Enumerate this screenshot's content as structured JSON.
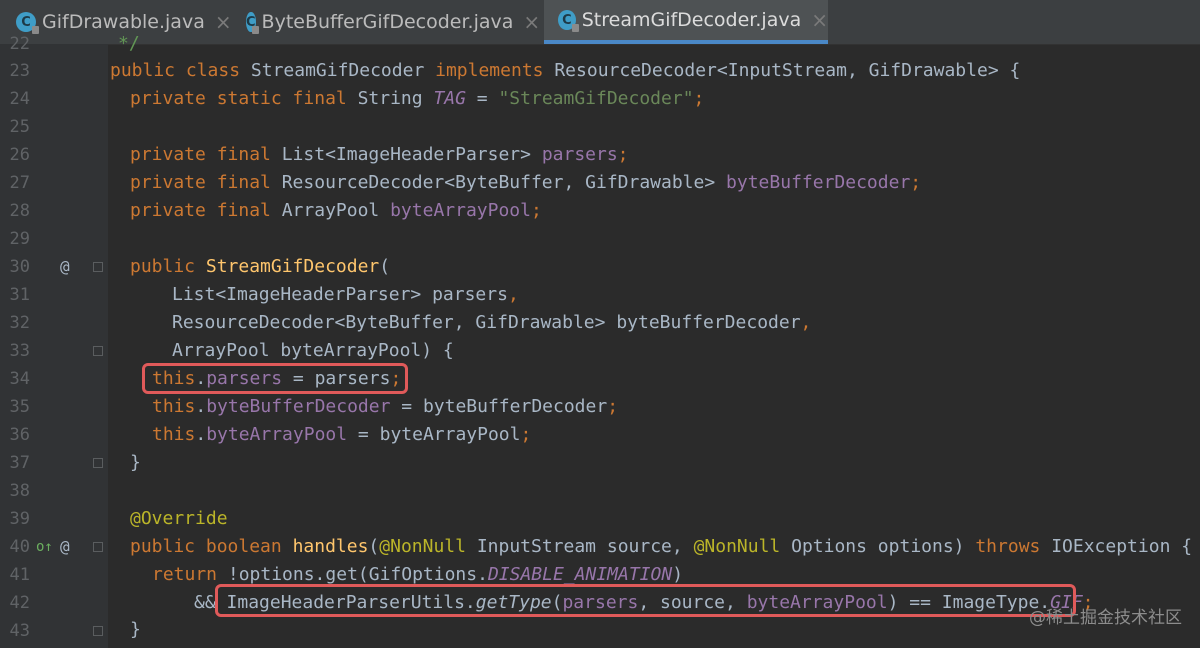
{
  "tabs": [
    {
      "label": "GifDrawable.java"
    },
    {
      "label": "ByteBufferGifDecoder.java"
    },
    {
      "label": "StreamGifDecoder.java"
    }
  ],
  "tab_icon_letter": "C",
  "close_glyph": "×",
  "gutter": {
    "line_numbers": [
      "22",
      "23",
      "24",
      "25",
      "26",
      "27",
      "28",
      "29",
      "30",
      "31",
      "32",
      "33",
      "34",
      "35",
      "36",
      "37",
      "38",
      "39",
      "40",
      "41",
      "42",
      "43"
    ],
    "override_marker": "@",
    "implements_marker": "o↑"
  },
  "code": {
    "l22": "*/",
    "l23": [
      "public class ",
      "StreamGifDecoder ",
      "implements ",
      "ResourceDecoder<InputStream, GifDrawable> {"
    ],
    "l24": [
      "private static final ",
      "String ",
      "TAG",
      " = ",
      "\"StreamGifDecoder\"",
      ";"
    ],
    "l26": [
      "private final ",
      "List<ImageHeaderParser> ",
      "parsers",
      ";"
    ],
    "l27": [
      "private final ",
      "ResourceDecoder<ByteBuffer, GifDrawable> ",
      "byteBufferDecoder",
      ";"
    ],
    "l28": [
      "private final ",
      "ArrayPool ",
      "byteArrayPool",
      ";"
    ],
    "l30": [
      "public ",
      "StreamGifDecoder",
      "("
    ],
    "l31": [
      "List<ImageHeaderParser> parsers",
      ","
    ],
    "l32": [
      "ResourceDecoder<ByteBuffer, GifDrawable> byteBufferDecoder",
      ","
    ],
    "l33": "ArrayPool byteArrayPool) {",
    "l34": [
      "this",
      ".",
      "parsers",
      " = parsers",
      ";"
    ],
    "l35": [
      "this",
      ".",
      "byteBufferDecoder",
      " = byteBufferDecoder",
      ";"
    ],
    "l36": [
      "this",
      ".",
      "byteArrayPool",
      " = byteArrayPool",
      ";"
    ],
    "l37": "}",
    "l39": "@Override",
    "l40": [
      "public boolean ",
      "handles",
      "(",
      "@NonNull ",
      "InputStream source, ",
      "@NonNull ",
      "Options options) ",
      "throws ",
      "IOException {"
    ],
    "l41": [
      "return ",
      "!options.get(GifOptions.",
      "DISABLE_ANIMATION",
      ")"
    ],
    "l42": [
      "&& ",
      "ImageHeaderParserUtils.",
      "getType",
      "(",
      "parsers",
      ", source, ",
      "byteArrayPool",
      ") == ImageType.",
      "GIF",
      ";"
    ],
    "l43": "}"
  },
  "watermark": "@稀土掘金技术社区",
  "colors": {
    "background": "#2b2b2b",
    "keyword": "#cc7832",
    "string": "#6a8759",
    "field": "#9876aa",
    "annotation": "#bbb529",
    "method": "#ffc66d",
    "highlight_box": "#e05a5a"
  }
}
